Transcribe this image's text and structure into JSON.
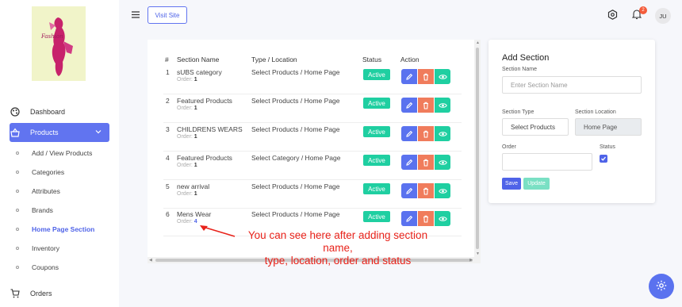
{
  "sidebar": {
    "items": [
      {
        "label": "Dashboard",
        "icon": "palette-icon"
      },
      {
        "label": "Products",
        "icon": "basket-icon"
      },
      {
        "label": "Orders",
        "icon": "cart-icon"
      }
    ],
    "sub_items": [
      {
        "label": "Add / View Products"
      },
      {
        "label": "Categories"
      },
      {
        "label": "Attributes"
      },
      {
        "label": "Brands"
      },
      {
        "label": "Home Page Section"
      },
      {
        "label": "Inventory"
      },
      {
        "label": "Coupons"
      }
    ],
    "active_sub": "Home Page Section"
  },
  "topbar": {
    "visit_site": "Visit Site",
    "notification_count": "2",
    "avatar_initials": "JU"
  },
  "table": {
    "headers": [
      "#",
      "Section Name",
      "Type / Location",
      "Status",
      "Action"
    ],
    "rows": [
      {
        "num": "1",
        "name": "sUBS category",
        "order_label": "Order:",
        "order": "1",
        "type_location": "Select Products / Home Page",
        "status": "Active"
      },
      {
        "num": "2",
        "name": "Featured Products",
        "order_label": "Order:",
        "order": "1",
        "type_location": "Select Products / Home Page",
        "status": "Active"
      },
      {
        "num": "3",
        "name": "CHILDRENS WEARS",
        "order_label": "Order:",
        "order": "1",
        "type_location": "Select Products / Home Page",
        "status": "Active"
      },
      {
        "num": "4",
        "name": "Featured Products",
        "order_label": "Order:",
        "order": "1",
        "type_location": "Select Category / Home Page",
        "status": "Active"
      },
      {
        "num": "5",
        "name": "new arrival",
        "order_label": "Order:",
        "order": "1",
        "type_location": "Select Products / Home Page",
        "status": "Active"
      },
      {
        "num": "6",
        "name": "Mens Wear",
        "order_label": "Order:",
        "order": "4",
        "type_location": "Select Products / Home Page",
        "status": "Active"
      }
    ]
  },
  "annotation": {
    "line1": "You can see here after adding section name,",
    "line2": "type, location, order and status"
  },
  "add_section": {
    "title": "Add Section",
    "section_name_label": "Section Name",
    "section_name_placeholder": "Enter Section Name",
    "section_type_label": "Section Type",
    "section_type_value": "Select Products",
    "section_location_label": "Section Location",
    "section_location_value": "Home Page",
    "order_label": "Order",
    "order_value": "",
    "status_label": "Status",
    "status_checked": true,
    "save_label": "Save",
    "update_label": "Update"
  },
  "colors": {
    "accent": "#6174f0",
    "active_badge": "#1fcfa1",
    "delete": "#f07c5c",
    "annotation": "#e8221a"
  }
}
